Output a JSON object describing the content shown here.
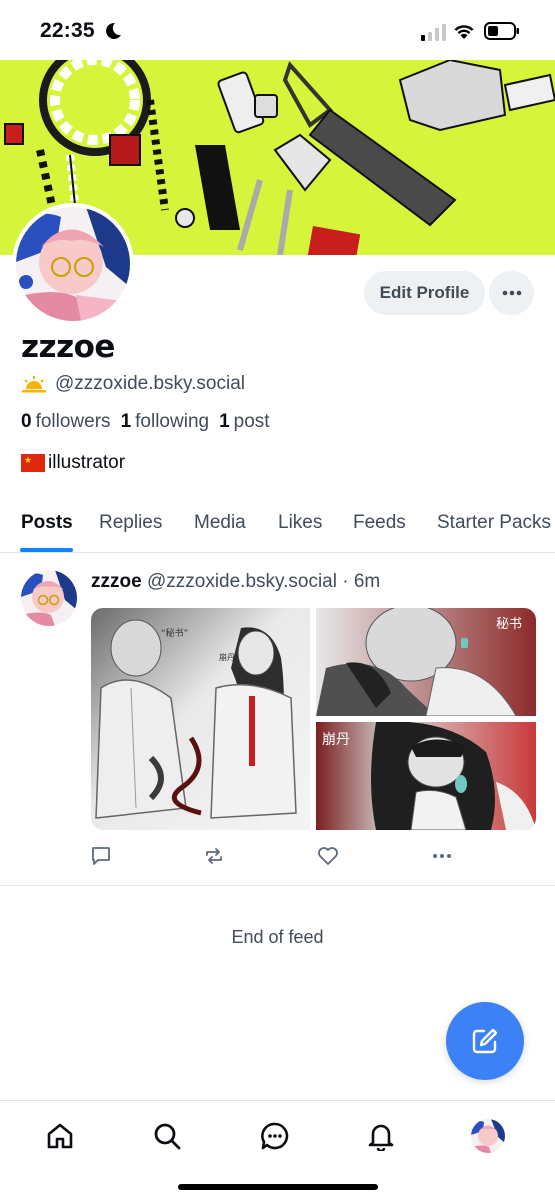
{
  "status_bar": {
    "time": "22:35"
  },
  "profile": {
    "display_name": "zzzoe",
    "handle": "@zzzoxide.bsky.social",
    "handle_emoji": "⛅",
    "followers_count": "0",
    "followers_label": "followers",
    "following_count": "1",
    "following_label": "following",
    "posts_count": "1",
    "posts_label": "post",
    "bio": "illustrator",
    "edit_profile_label": "Edit Profile"
  },
  "tabs": [
    {
      "label": "Posts",
      "active": true
    },
    {
      "label": "Replies"
    },
    {
      "label": "Media"
    },
    {
      "label": "Likes"
    },
    {
      "label": "Feeds"
    },
    {
      "label": "Starter Packs"
    }
  ],
  "post": {
    "author": "zzzoe",
    "handle": "@zzzoxide.bsky.social",
    "separator": "·",
    "time": "6m",
    "image_text": {
      "tag_a": "“秘书”",
      "tag_b": "崩丹",
      "caption_top": "秘书",
      "caption_bottom": "崩丹"
    }
  },
  "feed": {
    "end_label": "End of feed"
  },
  "colors": {
    "accent": "#1083fe",
    "compose": "#3c82f6",
    "banner": "#d6f53a"
  },
  "icons": {
    "nav": [
      "home-icon",
      "search-icon",
      "chat-icon",
      "bell-icon",
      "avatar"
    ],
    "post_actions": [
      "reply-icon",
      "repost-icon",
      "like-icon",
      "more-icon"
    ]
  }
}
